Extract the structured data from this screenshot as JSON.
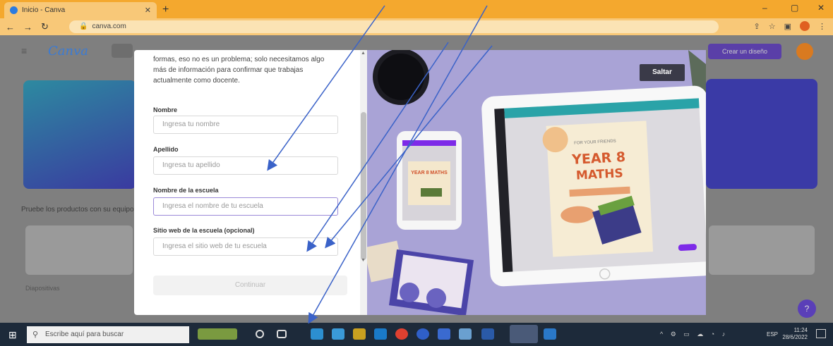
{
  "browser": {
    "tab_title": "Inicio - Canva",
    "tab_close": "✕",
    "new_tab": "+",
    "url": "canva.com",
    "window_controls": [
      "–",
      "▢",
      "✕"
    ]
  },
  "canva": {
    "menu_glyph": "≡",
    "logo": "Canva",
    "create_button": "Crear un diseño",
    "section_title": "Pruebe los productos con su equipo",
    "card_label": "Diapositivas",
    "fab": "?"
  },
  "modal": {
    "intro": "formas, eso no es un problema; solo necesitamos algo más de información para confirmar que trabajas actualmente como docente.",
    "fields": [
      {
        "label": "Nombre",
        "placeholder": "Ingresa tu nombre"
      },
      {
        "label": "Apellido",
        "placeholder": "Ingresa tu apellido"
      },
      {
        "label": "Nombre de la escuela",
        "placeholder": "Ingresa el nombre de tu escuela"
      },
      {
        "label": "Sitio web de la escuela (opcional)",
        "placeholder": "Ingresa el sitio web de tu escuela"
      }
    ],
    "continue_label": "Continuar",
    "skip_label": "Saltar",
    "poster_small": "YEAR 8 MATHS",
    "poster_top": "FOR YOUR FRIENDS",
    "poster_year": "YEAR 8",
    "poster_subject": "MATHS"
  },
  "taskbar": {
    "search_placeholder": "Escribe aquí para buscar",
    "lang": "ESP",
    "time": "11:24",
    "date": "28/6/2022"
  },
  "colors": {
    "tabstrip": "#f4a82e",
    "backdrop": "#7f7f7f",
    "accent": "#7d2ae8",
    "arrow": "#3a62c8",
    "modal_image": "#a9a3d6"
  }
}
